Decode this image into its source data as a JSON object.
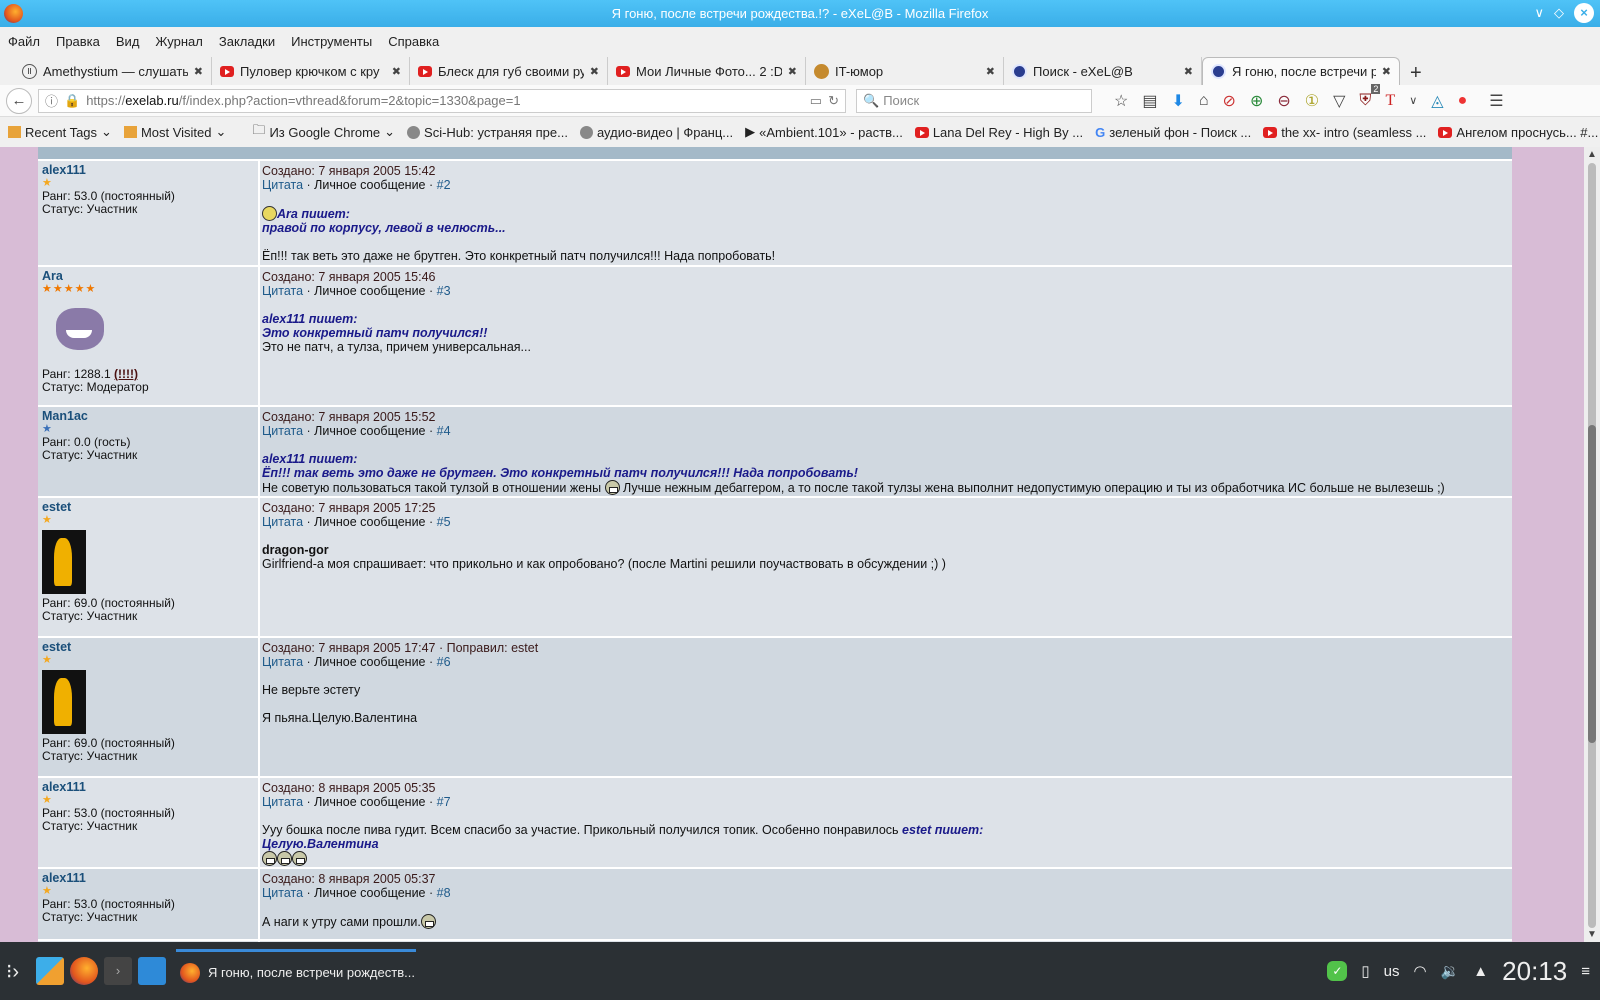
{
  "window": {
    "title": "Я гоню, после встречи рождества.!? - eXeL@B - Mozilla Firefox"
  },
  "menu": [
    "Файл",
    "Правка",
    "Вид",
    "Журнал",
    "Закладки",
    "Инструменты",
    "Справка"
  ],
  "tabs": [
    {
      "label": "Amethystium — слушать",
      "icon": "pause-icon"
    },
    {
      "label": "Пуловер крючком с кру",
      "icon": "youtube-icon"
    },
    {
      "label": "Блеск для губ своими ру",
      "icon": "youtube-icon"
    },
    {
      "label": "Мои Личные Фото... 2 :D",
      "icon": "youtube-icon"
    },
    {
      "label": "IT-юмор",
      "icon": "site-icon"
    },
    {
      "label": "Поиск - eXeL@B",
      "icon": "exelab-icon"
    },
    {
      "label": "Я гоню, после встречи р",
      "icon": "exelab-icon",
      "active": true
    }
  ],
  "nav": {
    "url_prefix": "https://",
    "url_domain": "exelab.ru",
    "url_path": "/f/index.php?action=vthread&forum=2&topic=1330&page=1",
    "search_placeholder": "Поиск",
    "ublock_badge": "2"
  },
  "bookmarks": [
    "Recent Tags",
    "Most Visited",
    "Из Google Chrome",
    "Sci-Hub: устраняя пре...",
    "аудио-видео | Франц...",
    "«Ambient.101» - раств...",
    "Lana Del Rey - High By ...",
    "зеленый фон - Поиск ...",
    "the xx- intro (seamless ...",
    "Ангелом проснусь... #..."
  ],
  "labels": {
    "quote": "Цитата",
    "pm": "Личное сообщение",
    "sep": " · ",
    "edited_by": "Поправил: "
  },
  "posts": [
    {
      "user": "alex111",
      "stars": "★",
      "rank": "Ранг: 53.0 (постоянный)",
      "status": "Статус: Участник",
      "created": "Создано: 7 января 2005 15:42",
      "num": "#2",
      "q1": "Ara пишет:",
      "q2": "правой по корпусу, левой в челюсть...",
      "text": "Ёп!!! так веть это даже не брутген. Это конкретный патч получился!!! Нада попробовать!"
    },
    {
      "user": "Ara",
      "stars": "★★★★★",
      "rank": "Ранг: 1288.1",
      "rank_extra": "(!!!!)",
      "status": "Статус: Модератор",
      "created": "Создано: 7 января 2005 15:46",
      "num": "#3",
      "q1": "alex111 пишет:",
      "q2": "Это конкретный патч получился!!",
      "text": "Это не патч, а тулза, причем универсальная..."
    },
    {
      "user": "Man1ac",
      "stars": "★",
      "rank": "Ранг: 0.0 (гость)",
      "status": "Статус: Участник",
      "created": "Создано: 7 января 2005 15:52",
      "num": "#4",
      "q1": "alex111 пишет:",
      "q2": "Ёп!!! так веть это даже не брутген. Это конкретный патч получился!!! Нада попробовать!",
      "text1": "Не советую пользоваться такой тулзой в отношении жены",
      "text2": "Лучше нежным дебаггером, а то после такой тулзы жена выполнит недопустимую операцию и ты из обработчика ИС больше не вылезешь ;)"
    },
    {
      "user": "estet",
      "stars": "★",
      "rank": "Ранг: 69.0 (постоянный)",
      "status": "Статус: Участник",
      "created": "Создано: 7 января 2005 17:25",
      "num": "#5",
      "bold": "dragon-gor",
      "text": "Girlfriend-а моя спрашивает: что прикольно и как опробовано? (после Martini решили поучаствовать в обсуждении ;) )"
    },
    {
      "user": "estet",
      "stars": "★",
      "rank": "Ранг: 69.0 (постоянный)",
      "status": "Статус: Участник",
      "created": "Создано: 7 января 2005 17:47",
      "editor": "estet",
      "num": "#6",
      "text1": "Не верьте эстету",
      "text2": "Я пьяна.Целую.Валентина"
    },
    {
      "user": "alex111",
      "stars": "★",
      "rank": "Ранг: 53.0 (постоянный)",
      "status": "Статус: Участник",
      "created": "Создано: 8 января 2005 05:35",
      "num": "#7",
      "text": "Ууу бошка после пива гудит. Всем спасибо за участие. Прикольный получился топик. Особенно понравилось",
      "q1": "estet пишет:",
      "q2": "Целую.Валентина"
    },
    {
      "user": "alex111",
      "stars": "★",
      "rank": "Ранг: 53.0 (постоянный)",
      "status": "Статус: Участник",
      "created": "Создано: 8 января 2005 05:37",
      "num": "#8",
      "text": "А наги к утру сами прошли."
    }
  ],
  "taskbar": {
    "window_label": "Я гоню, после встречи рождеств...",
    "layout": "us",
    "clock": "20:13"
  }
}
